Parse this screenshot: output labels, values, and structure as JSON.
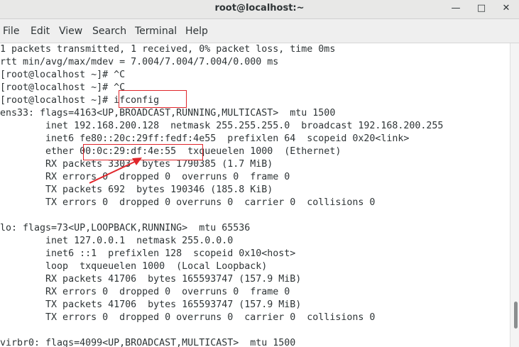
{
  "window": {
    "title": "root@localhost:~",
    "minimize_glyph": "—",
    "maximize_glyph": "□",
    "close_glyph": "✕"
  },
  "menu": [
    "File",
    "Edit",
    "View",
    "Search",
    "Terminal",
    "Help"
  ],
  "terminal_lines": [
    "1 packets transmitted, 1 received, 0% packet loss, time 0ms",
    "rtt min/avg/max/mdev = 7.004/7.004/7.004/0.000 ms",
    "[root@localhost ~]# ^C",
    "[root@localhost ~]# ^C",
    "[root@localhost ~]# ifconfig",
    "ens33: flags=4163<UP,BROADCAST,RUNNING,MULTICAST>  mtu 1500",
    "        inet 192.168.200.128  netmask 255.255.255.0  broadcast 192.168.200.255",
    "        inet6 fe80::20c:29ff:fedf:4e55  prefixlen 64  scopeid 0x20<link>",
    "        ether 00:0c:29:df:4e:55  txqueuelen 1000  (Ethernet)",
    "        RX packets 3303  bytes 1790385 (1.7 MiB)",
    "        RX errors 0  dropped 0  overruns 0  frame 0",
    "        TX packets 692  bytes 190346 (185.8 KiB)",
    "        TX errors 0  dropped 0 overruns 0  carrier 0  collisions 0",
    "",
    "lo: flags=73<UP,LOOPBACK,RUNNING>  mtu 65536",
    "        inet 127.0.0.1  netmask 255.0.0.0",
    "        inet6 ::1  prefixlen 128  scopeid 0x10<host>",
    "        loop  txqueuelen 1000  (Local Loopback)",
    "        RX packets 41706  bytes 165593747 (157.9 MiB)",
    "        RX errors 0  dropped 0  overruns 0  frame 0",
    "        TX packets 41706  bytes 165593747 (157.9 MiB)",
    "        TX errors 0  dropped 0 overruns 0  carrier 0  collisions 0",
    "",
    "virbr0: flags=4099<UP,BROADCAST,MULTICAST>  mtu 1500"
  ],
  "annotation_color": "#e0262b"
}
